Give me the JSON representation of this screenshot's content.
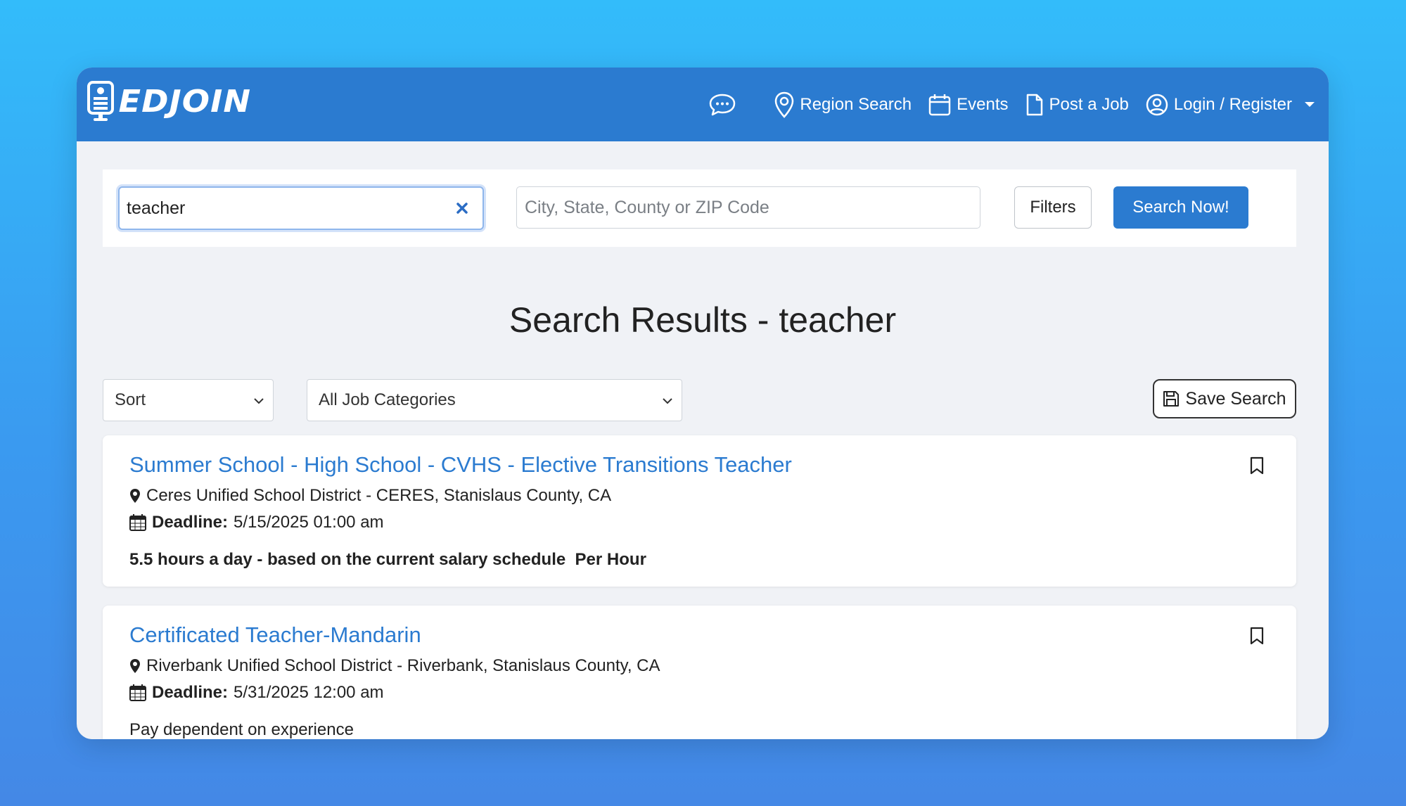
{
  "brand": {
    "name": "EDJOIN"
  },
  "nav": {
    "chat_icon": "chat-bubble-icon",
    "items": [
      {
        "label": "Region Search",
        "icon": "map-pin-icon"
      },
      {
        "label": "Events",
        "icon": "calendar-icon"
      },
      {
        "label": "Post a Job",
        "icon": "document-icon"
      },
      {
        "label": "Login / Register",
        "icon": "user-circle-icon"
      }
    ]
  },
  "search": {
    "keyword_value": "teacher",
    "location_placeholder": "City, State, County or ZIP Code",
    "filters_label": "Filters",
    "submit_label": "Search Now!"
  },
  "results": {
    "title": "Search Results - teacher",
    "sort_label": "Sort",
    "category_label": "All Job Categories",
    "save_search_label": "Save Search"
  },
  "jobs": [
    {
      "title": "Summer School - High School - CVHS - Elective Transitions Teacher",
      "location": "Ceres Unified School District - CERES, Stanislaus County, CA",
      "deadline_label": "Deadline:",
      "deadline_value": "5/15/2025 01:00 am",
      "description": "5.5 hours a day - based on the current salary schedule  Per Hour"
    },
    {
      "title": "Certificated Teacher-Mandarin",
      "location": "Riverbank Unified School District - Riverbank, Stanislaus County, CA",
      "deadline_label": "Deadline:",
      "deadline_value": "5/31/2025 12:00 am",
      "description": "Pay dependent on experience"
    }
  ],
  "colors": {
    "brand_blue": "#2b7bd0",
    "page_bg": "#f0f2f6"
  }
}
